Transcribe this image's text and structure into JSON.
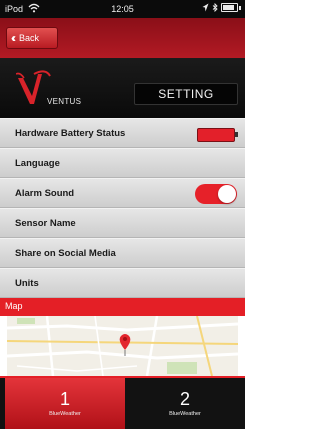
{
  "status_bar": {
    "carrier": "iPod",
    "time": "12:05"
  },
  "nav": {
    "back_label": "Back"
  },
  "header": {
    "brand": "VENTUS",
    "section_title": "SETTING"
  },
  "settings": {
    "items": [
      {
        "label": "Hardware Battery Status"
      },
      {
        "label": "Language"
      },
      {
        "label": "Alarm Sound",
        "toggle_on": true
      },
      {
        "label": "Sensor Name"
      },
      {
        "label": "Share on Social Media"
      },
      {
        "label": "Units"
      }
    ]
  },
  "map": {
    "title": "Map"
  },
  "tabs": [
    {
      "number": "1",
      "label": "BlueWeather",
      "selected": true
    },
    {
      "number": "2",
      "label": "BlueWeather",
      "selected": false
    }
  ],
  "colors": {
    "accent_red": "#e41f26",
    "dark": "#0a0a0a",
    "row_gray": "#d9d9d9"
  }
}
